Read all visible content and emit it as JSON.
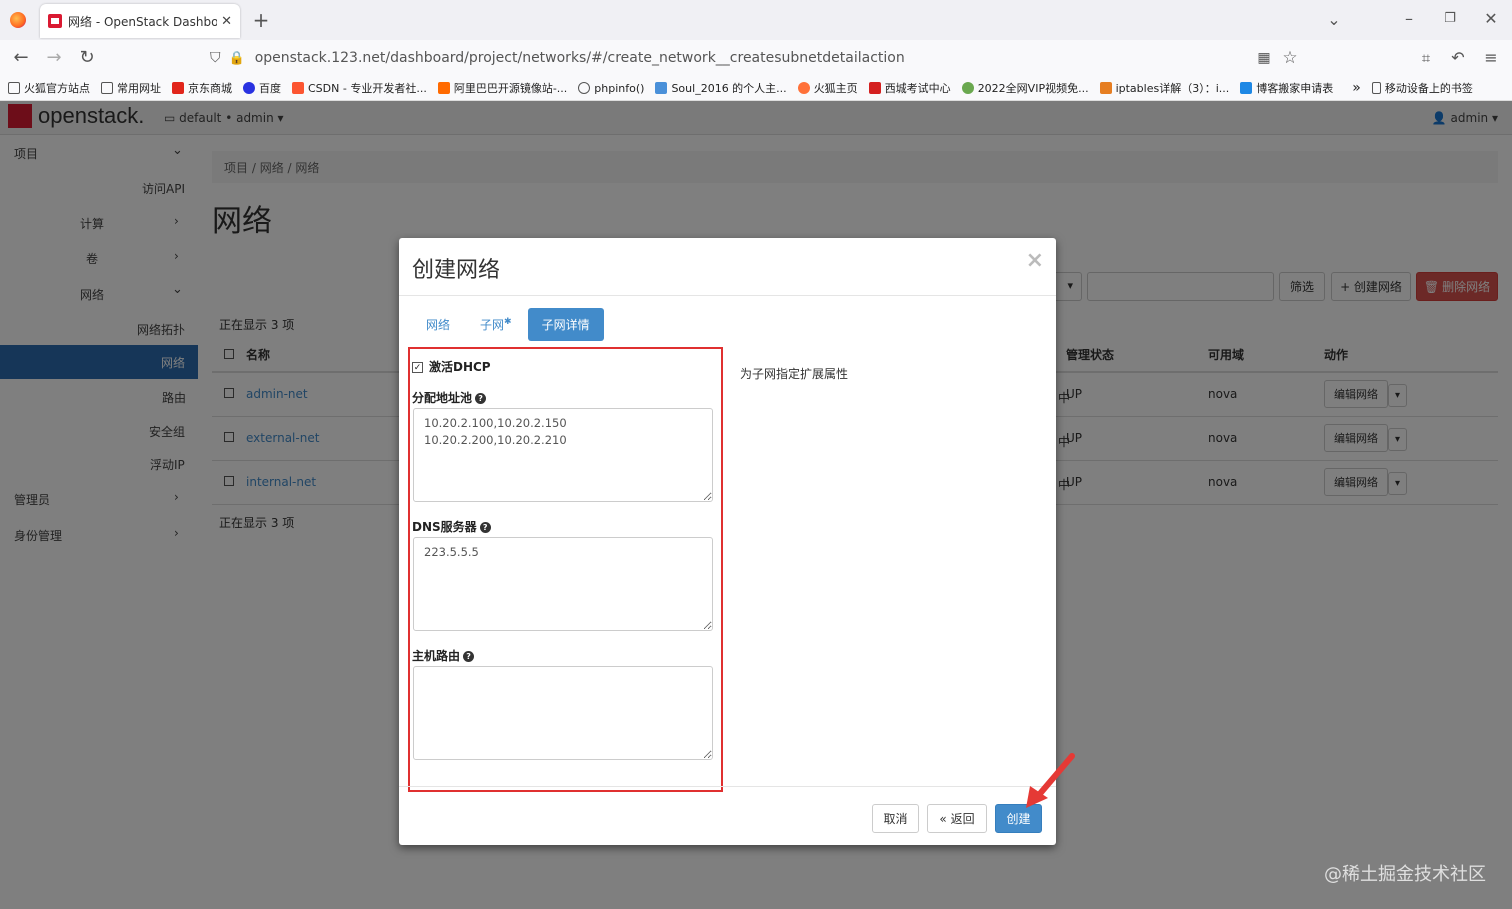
{
  "browser": {
    "tab_title": "网络 - OpenStack Dashboard",
    "url_host": "openstack.123.net",
    "url_path": "/dashboard/project/networks/#/create_network__createsubnetdetailaction",
    "bookmarks": [
      "火狐官方站点",
      "常用网址",
      "京东商城",
      "百度",
      "CSDN - 专业开发者社...",
      "阿里巴巴开源镜像站-...",
      "phpinfo()",
      "Soul_2016 的个人主...",
      "火狐主页",
      "西城考试中心",
      "2022全网VIP视频免...",
      "iptables详解（3）：i...",
      "博客搬家申请表"
    ],
    "mobile_bookmarks": "移动设备上的书签"
  },
  "header": {
    "logo": "openstack.",
    "project_selector": "default • admin",
    "user_menu": "admin"
  },
  "sidebar": {
    "project": "项目",
    "access_api": "访问API",
    "compute": "计算",
    "volumes": "卷",
    "network": "网络",
    "network_topology": "网络拓扑",
    "networks": "网络",
    "routers": "路由",
    "security_groups": "安全组",
    "floating_ip": "浮动IP",
    "admin": "管理员",
    "identity": "身份管理"
  },
  "main": {
    "breadcrumb": [
      "项目",
      "网络",
      "网络"
    ],
    "page_title": "网络",
    "filter_button": "筛选",
    "create_network_button": "+ 创建网络",
    "delete_network_button": "删除网络",
    "showing_top": "正在显示 3 项",
    "showing_bottom": "正在显示 3 项",
    "columns": {
      "name": "名称",
      "admin_state": "管理状态",
      "availability_zone": "可用域",
      "actions": "动作"
    },
    "rows": [
      {
        "name": "admin-net",
        "admin_state": "UP",
        "zone": "nova",
        "action": "编辑网络",
        "status_tail": "中"
      },
      {
        "name": "external-net",
        "admin_state": "UP",
        "zone": "nova",
        "action": "编辑网络",
        "status_tail": "中"
      },
      {
        "name": "internal-net",
        "admin_state": "UP",
        "zone": "nova",
        "action": "编辑网络",
        "status_tail": "中"
      }
    ]
  },
  "modal": {
    "title": "创建网络",
    "tabs": [
      "网络",
      "子网",
      "子网详情"
    ],
    "enable_dhcp_label": "激活DHCP",
    "allocation_pools_label": "分配地址池",
    "allocation_pools_value": "10.20.2.100,10.20.2.150\n10.20.2.200,10.20.2.210",
    "dns_label": "DNS服务器",
    "dns_value": "223.5.5.5",
    "host_routes_label": "主机路由",
    "host_routes_value": "",
    "help_text": "为子网指定扩展属性",
    "cancel": "取消",
    "back": "« 返回",
    "create": "创建"
  },
  "watermark": "@稀土掘金技术社区"
}
